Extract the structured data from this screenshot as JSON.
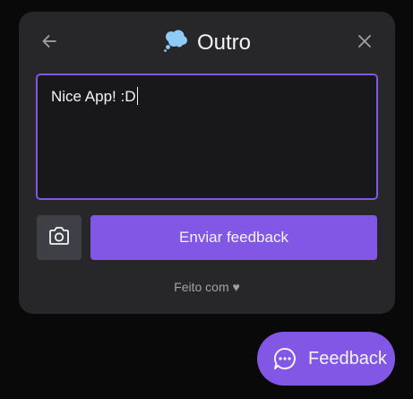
{
  "widget": {
    "title": "Outro",
    "type_icon": "thought-bubble-icon",
    "back_icon": "arrow-left-icon",
    "close_icon": "close-icon",
    "textarea_value": "Nice App! :D",
    "camera_icon": "camera-icon",
    "submit_label": "Enviar feedback",
    "footer_text": "Feito com ♥"
  },
  "launcher": {
    "label": "Feedback",
    "icon": "chat-bubble-icon"
  },
  "colors": {
    "accent": "#8257e5",
    "panel_bg": "#27272a",
    "field_bg": "#18181b",
    "page_bg": "#09090a",
    "text": "#f4f4f5",
    "muted": "#a1a1aa"
  }
}
